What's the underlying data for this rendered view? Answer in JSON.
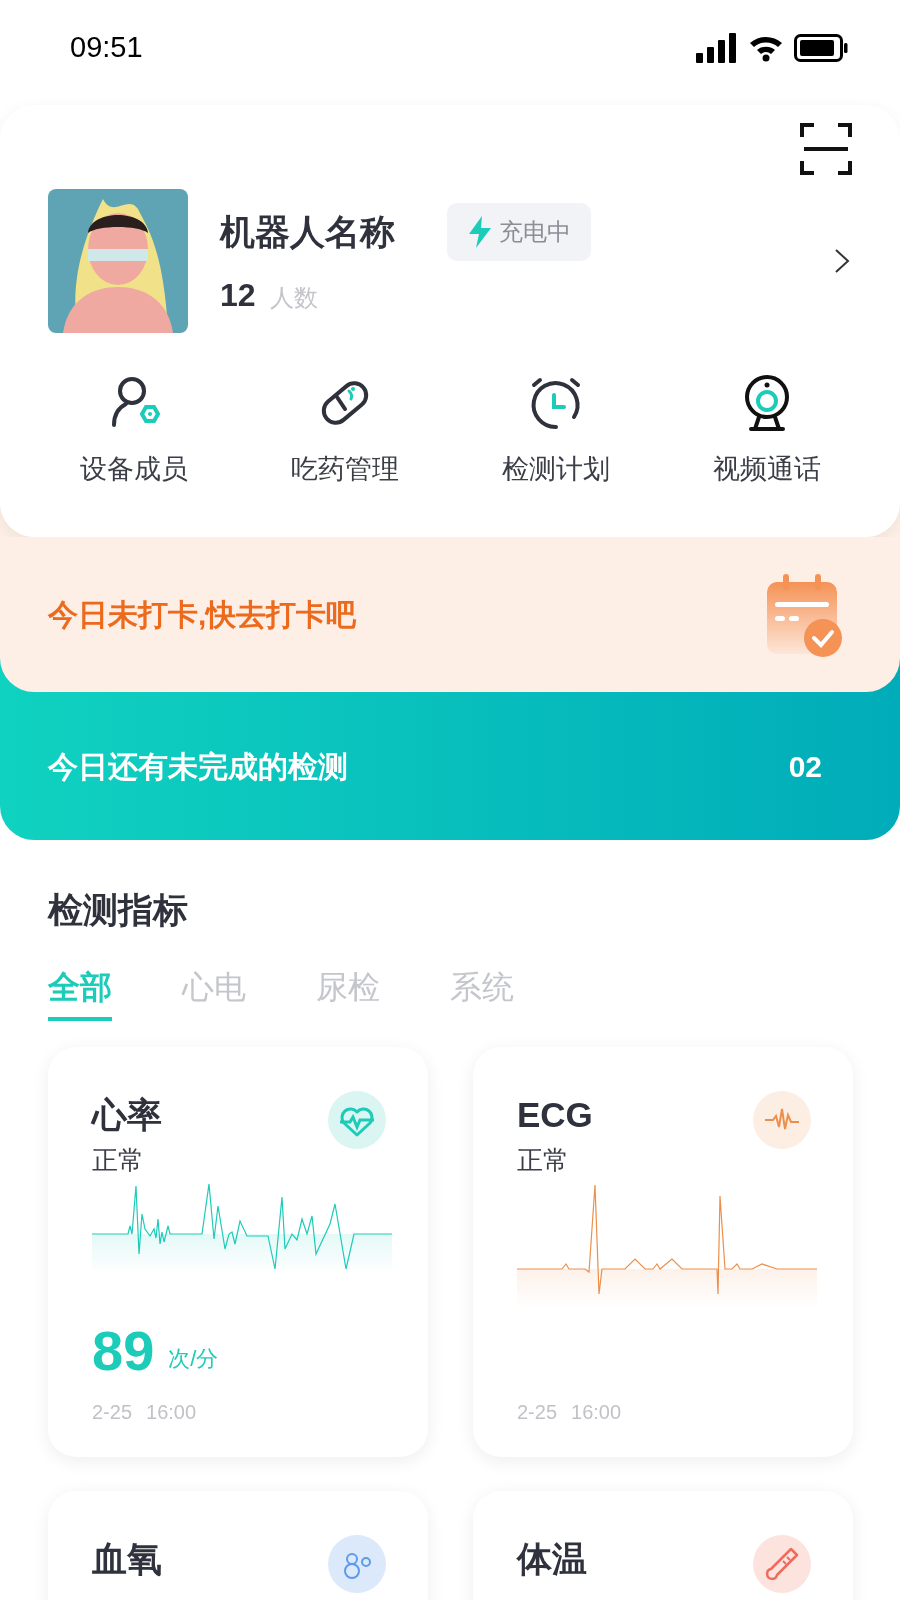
{
  "status_bar": {
    "time": "09:51"
  },
  "robot": {
    "name": "机器人名称",
    "badge": "充电中",
    "count": "12",
    "count_label": "人数"
  },
  "actions": [
    {
      "kind": "members",
      "label": "设备成员"
    },
    {
      "kind": "medicine",
      "label": "吃药管理"
    },
    {
      "kind": "plan",
      "label": "检测计划"
    },
    {
      "kind": "video",
      "label": "视频通话"
    }
  ],
  "checkin_banner": {
    "text": "今日未打卡,快去打卡吧"
  },
  "pending_banner": {
    "text": "今日还有未完成的检测",
    "count": "02"
  },
  "section": {
    "title": "检测指标"
  },
  "tabs": [
    {
      "label": "全部",
      "selected": true
    },
    {
      "label": "心电",
      "selected": false
    },
    {
      "label": "尿检",
      "selected": false
    },
    {
      "label": "系统",
      "selected": false
    }
  ],
  "cards": [
    {
      "kind": "heart",
      "title": "心率",
      "status": "正常",
      "value": "89",
      "unit": "次/分",
      "date": "2-25",
      "time": "16:00",
      "color": "#1ccbb8"
    },
    {
      "kind": "ecg",
      "title": "ECG",
      "status": "正常",
      "date": "2-25",
      "time": "16:00",
      "color": "#eb8f4c"
    },
    {
      "kind": "oxygen",
      "title": "血氧",
      "color": "#5d9be8"
    },
    {
      "kind": "temperature",
      "title": "体温",
      "color": "#ef6b5d"
    }
  ]
}
